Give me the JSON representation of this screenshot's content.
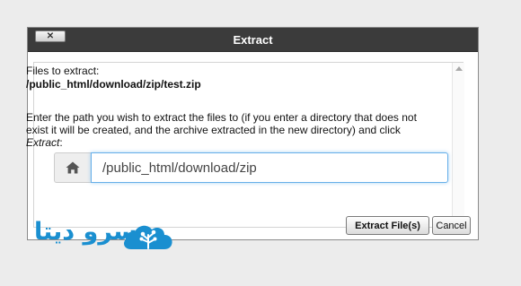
{
  "dialog": {
    "title": "Extract",
    "close_label": "✕",
    "files_label": "Files to extract:",
    "files_path": "/public_html/download/zip/test.zip",
    "instructions_main": "Enter the path you wish to extract the files to (if you enter a directory that does not exist it will be created, and the archive extracted in the new directory) and click ",
    "instructions_action": "Extract",
    "instructions_end": ":",
    "path_value": "/public_html/download/zip",
    "home_icon": "home-icon",
    "extract_button": "Extract File(s)",
    "cancel_button": "Cancel"
  },
  "logo": {
    "text": "سرو دیتا",
    "icon": "cloud-tree-icon",
    "color": "#1a8fd0"
  }
}
